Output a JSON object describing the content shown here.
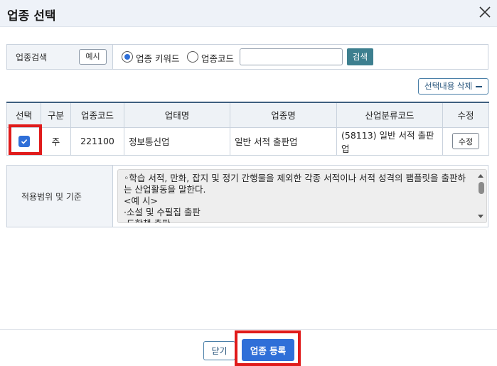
{
  "dialog": {
    "title": "업종 선택",
    "close_icon": "close-icon"
  },
  "search": {
    "label": "업종검색",
    "example_button": "예시",
    "radio_options": [
      {
        "label": "업종 키워드",
        "selected": true
      },
      {
        "label": "업종코드",
        "selected": false
      }
    ],
    "input_value": "",
    "search_button": "검색",
    "accent_color": "#3d7f8f"
  },
  "clear_selection_button": "선택내용 삭제",
  "table": {
    "headers": [
      "선택",
      "구분",
      "업종코드",
      "업태명",
      "업종명",
      "산업분류코드",
      "수정"
    ],
    "rows": [
      {
        "selected": true,
        "type": "주",
        "code": "221100",
        "business_type": "정보통신업",
        "industry_name": "일반 서적 출판업",
        "classification": "(58113) 일반 서적 출판업",
        "edit_label": "수정"
      }
    ]
  },
  "scope": {
    "label": "적용범위 및 기준",
    "text": "◦학습 서적, 만화, 잡지 및 정기 간행물을 제외한 각종 서적이나 서적 성격의 팸플릿을 출판하는 산업활동을 말한다.\n<예 시>\n·소설 및 수필집 출판\n·도학책 출판"
  },
  "footer": {
    "close_button": "닫기",
    "register_button": "업종 등록",
    "primary_color": "#2f6fd8"
  },
  "highlight_color": "#e01b1b"
}
